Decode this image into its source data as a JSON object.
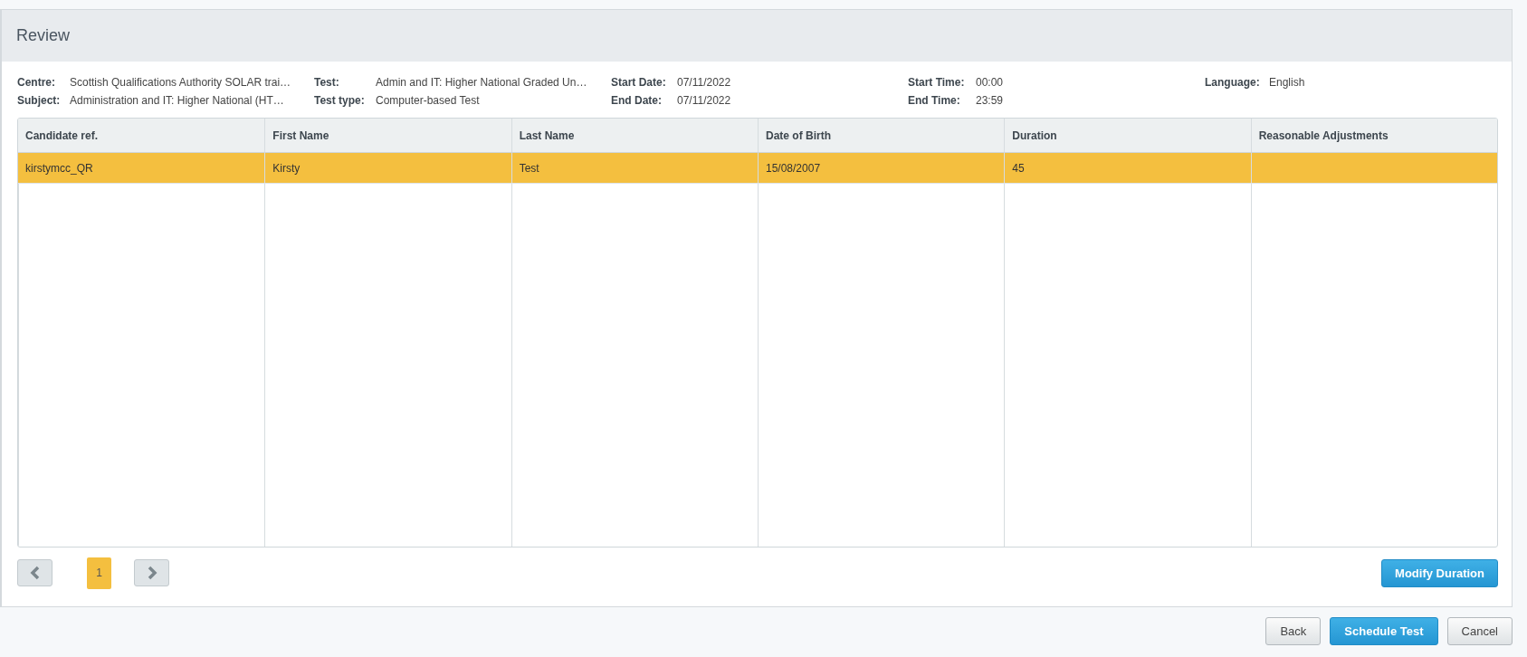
{
  "panel": {
    "title": "Review"
  },
  "details": [
    {
      "label": "Centre:",
      "value": "Scottish Qualifications Authority SOLAR trai…"
    },
    {
      "label": "Test:",
      "value": "Admin and IT: Higher National Graded Un…"
    },
    {
      "label": "Start Date:",
      "value": "07/11/2022"
    },
    {
      "label": "Start Time:",
      "value": "00:00"
    },
    {
      "label": "Language:",
      "value": "English"
    },
    {
      "label": "Subject:",
      "value": "Administration and IT: Higher National (HT…"
    },
    {
      "label": "Test type:",
      "value": "Computer-based Test"
    },
    {
      "label": "End Date:",
      "value": "07/11/2022"
    },
    {
      "label": "End Time:",
      "value": "23:59"
    }
  ],
  "table": {
    "columns": [
      "Candidate ref.",
      "First Name",
      "Last Name",
      "Date of Birth",
      "Duration",
      "Reasonable Adjustments"
    ],
    "rows": [
      {
        "cells": [
          "kirstymcc_QR",
          "Kirsty",
          "Test",
          "15/08/2007",
          "45"
        ],
        "selected": true
      }
    ]
  },
  "pagination": {
    "pages": [
      {
        "label": "1",
        "selected": true
      }
    ]
  },
  "table_actions": [
    "Modify Duration"
  ],
  "footer_buttons": [
    {
      "label": "Back",
      "kind": "secondary"
    },
    {
      "label": "Schedule Test",
      "kind": "primary"
    },
    {
      "label": "Cancel",
      "kind": "secondary"
    }
  ]
}
